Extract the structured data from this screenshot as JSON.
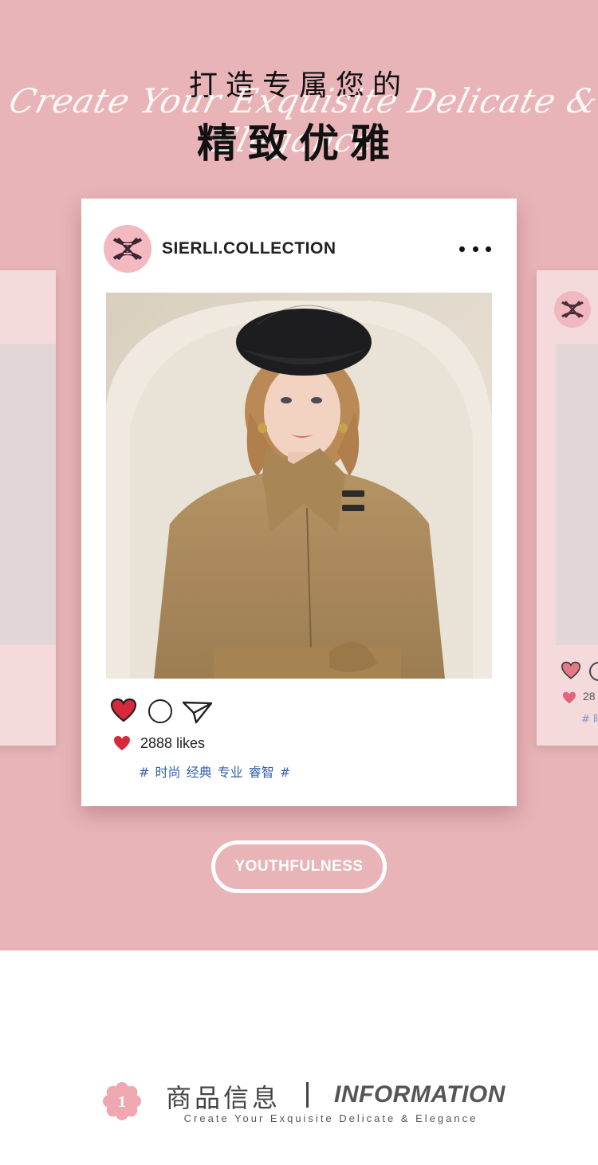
{
  "hero": {
    "title_line1": "打造专属您的",
    "script_line": "Create Your Exquisite Delicate & Elegance",
    "title_line2": "精致优雅",
    "background_color": "#e8b4b7"
  },
  "post": {
    "brand_name": "SIERLI.COLLECTION",
    "likes_text": "2888 likes",
    "tags_text": "# 时尚 经典 专业 睿智 #",
    "like_color": "#d8293c",
    "tag_color": "#3560a8"
  },
  "side_cards": {
    "right_likes_text": "28",
    "right_tags_text": "# 时"
  },
  "youthfulness_button": {
    "label": "YOUTHFULNESS"
  },
  "info_section": {
    "number": "1",
    "title_cn": "商品信息",
    "title_en": "INFORMATION",
    "subtitle": "Create Your Exquisite Delicate & Elegance"
  },
  "icons": {
    "logo": "brand-monogram-icon",
    "more": "more-dots-icon",
    "like": "heart-icon",
    "comment": "comment-icon",
    "share": "send-icon",
    "section_badge": "flower-icon"
  }
}
